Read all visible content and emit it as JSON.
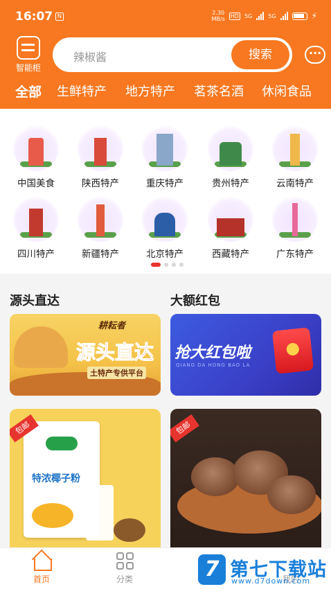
{
  "status_bar": {
    "time": "16:07",
    "nfc": "N",
    "net_speed": "2.30",
    "net_unit": "MB/s",
    "hd": "HD",
    "sim1": "5G",
    "sim2": "5G"
  },
  "header": {
    "locker_label": "智能柜",
    "search_placeholder": "辣椒酱",
    "search_button": "搜索",
    "message_icon": "chat-bubble-icon"
  },
  "categories": [
    {
      "label": "全部",
      "active": true
    },
    {
      "label": "生鲜特产",
      "active": false
    },
    {
      "label": "地方特产",
      "active": false
    },
    {
      "label": "茗茶名酒",
      "active": false
    },
    {
      "label": "休闲食品",
      "active": false
    }
  ],
  "regions": [
    {
      "name": "中国美食"
    },
    {
      "name": "陕西特产"
    },
    {
      "name": "重庆特产"
    },
    {
      "name": "贵州特产"
    },
    {
      "name": "云南特产"
    },
    {
      "name": "四川特产"
    },
    {
      "name": "新疆特产"
    },
    {
      "name": "北京特产"
    },
    {
      "name": "西藏特产"
    },
    {
      "name": "广东特产"
    }
  ],
  "region_page_count": 4,
  "region_page_active": 1,
  "sections": {
    "left_title": "源头直达",
    "right_title": "大额红包"
  },
  "banners": {
    "left": {
      "script": "耕耘者",
      "headline": "源头直达",
      "sub": "土特产专供平台"
    },
    "right": {
      "headline": "抢大红包啦",
      "sub": "QIANG DA HONG BAO LA"
    }
  },
  "products": [
    {
      "tag": "包邮",
      "package_text": "特浓椰子粉"
    },
    {
      "tag": "包邮"
    }
  ],
  "nav": {
    "home": "首页",
    "category": "分类",
    "mine": "我的"
  },
  "watermark": {
    "badge": "7",
    "text": "第七下载站",
    "url": "www.d7down.com"
  },
  "colors": {
    "brand": "#f77820",
    "red": "#e8342e",
    "watermark_blue": "#1a7fd9"
  }
}
